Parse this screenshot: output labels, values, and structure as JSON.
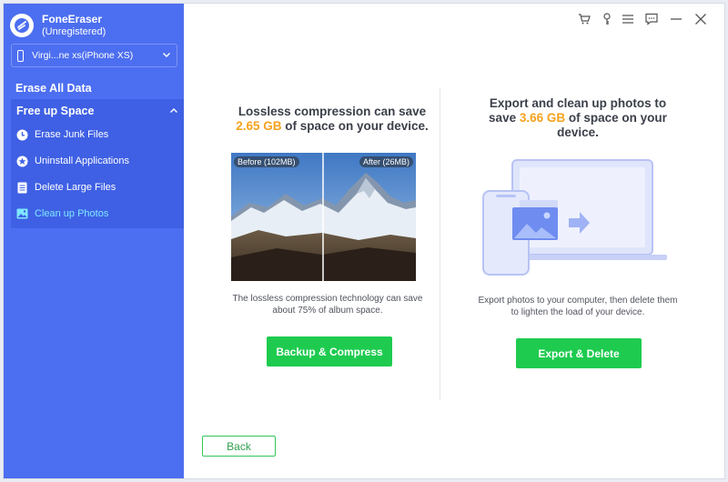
{
  "app": {
    "name": "FoneEraser",
    "status": "(Unregistered)"
  },
  "device": {
    "label": "Virgi...ne xs(iPhone XS)"
  },
  "sidebar": {
    "erase_all": "Erase All Data",
    "free_up": "Free up Space",
    "items": [
      {
        "label": "Erase Junk Files",
        "icon": "clock-icon"
      },
      {
        "label": "Uninstall Applications",
        "icon": "star-badge-icon"
      },
      {
        "label": "Delete Large Files",
        "icon": "file-icon"
      },
      {
        "label": "Clean up Photos",
        "icon": "photo-icon",
        "active": true
      }
    ]
  },
  "toolbar": {
    "icons": [
      "cart-icon",
      "key-icon",
      "menu-icon",
      "feedback-icon",
      "minimize-icon",
      "close-icon"
    ]
  },
  "left_panel": {
    "title_line1": "Lossless compression can save",
    "title_amount": "2.65 GB",
    "title_rest": "of space on your device.",
    "before_tag": "Before (102MB)",
    "after_tag": "After (26MB)",
    "desc_line1": "The lossless compression technology can save",
    "desc_line2": "about 75% of album space.",
    "button": "Backup & Compress"
  },
  "right_panel": {
    "title_line1": "Export and clean up photos to",
    "title_pre": "save",
    "title_amount": "3.66 GB",
    "title_rest": "of space on your",
    "title_line3": "device.",
    "desc_line1": "Export photos to your computer, then delete them",
    "desc_line2": "to lighten the load of your device.",
    "button": "Export & Delete"
  },
  "footer": {
    "back": "Back"
  },
  "colors": {
    "sidebar": "#4c6ef0",
    "sidebar_section": "#3f60e4",
    "active_item": "#7fe7ff",
    "accent": "#f6a21e",
    "button": "#1ecb4f"
  }
}
